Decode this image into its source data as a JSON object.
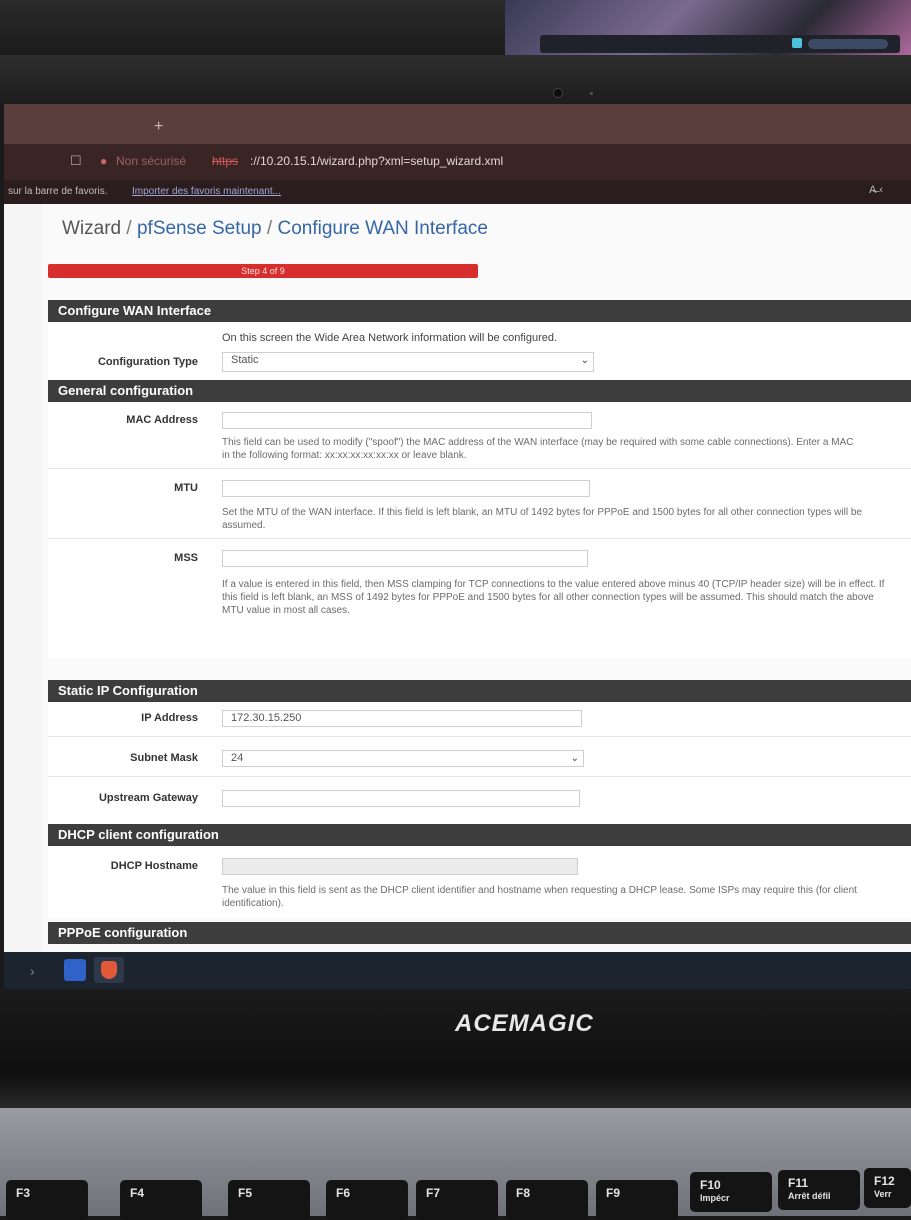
{
  "browser": {
    "tab_new": "+",
    "bookmark_icon": "bookmark-icon",
    "security_label": "Non sécurisé",
    "url_scheme": "https",
    "url_rest": "://10.20.15.1/wizard.php?xml=setup_wizard.xml",
    "bookmarks_bar_text": "sur la barre de favoris.",
    "bookmarks_import_link": "Importer des favoris maintenant...",
    "translate_icon": "translate-icon"
  },
  "breadcrumb": {
    "root": "Wizard",
    "sep": " / ",
    "middle": "pfSense Setup",
    "current": "Configure WAN Interface"
  },
  "progress": {
    "label": "Step 4 of 9",
    "step": 4,
    "total": 9,
    "color": "#d82d2d"
  },
  "sections": {
    "configure_wan": {
      "title": "Configure WAN Interface",
      "intro": "On this screen the Wide Area Network information will be configured.",
      "config_type_label": "Configuration Type",
      "config_type_value": "Static"
    },
    "general": {
      "title": "General configuration",
      "mac_label": "MAC Address",
      "mac_value": "",
      "mac_help_1": "This field can be used to modify (\"spoof\") the MAC address of the WAN interface (may be required with some cable connections). Enter a MAC",
      "mac_help_2": "in the following format: xx:xx:xx:xx:xx:xx or leave blank.",
      "mtu_label": "MTU",
      "mtu_value": "",
      "mtu_help_1": "Set the MTU of the WAN interface. If this field is left blank, an MTU of 1492 bytes for PPPoE and 1500 bytes for all other connection types will be",
      "mtu_help_2": "assumed.",
      "mss_label": "MSS",
      "mss_value": "",
      "mss_help_1": "If a value is entered in this field, then MSS clamping for TCP connections to the value entered above minus 40 (TCP/IP header size) will be in effect. If",
      "mss_help_2": "this field is left blank, an MSS of 1492 bytes for PPPoE and 1500 bytes for all other connection types will be assumed. This should match the above",
      "mss_help_3": "MTU value in most all cases."
    },
    "static_ip": {
      "title": "Static IP Configuration",
      "ip_label": "IP Address",
      "ip_value": "172.30.15.250",
      "mask_label": "Subnet Mask",
      "mask_value": "24",
      "gateway_label": "Upstream Gateway",
      "gateway_value": ""
    },
    "dhcp": {
      "title": "DHCP client configuration",
      "hostname_label": "DHCP Hostname",
      "hostname_value": "",
      "hostname_help_1": "The value in this field is sent as the DHCP client identifier and hostname when requesting a DHCP lease. Some ISPs may require this (for client",
      "hostname_help_2": "identification)."
    },
    "pppoe": {
      "title": "PPPoE configuration"
    }
  },
  "taskbar": {
    "chevron": "›",
    "apps": [
      "edge-icon",
      "brave-icon"
    ]
  },
  "laptop": {
    "brand": "ACEMAGIC"
  },
  "keyboard": {
    "keys": [
      {
        "label": "F3",
        "sub": ""
      },
      {
        "label": "F4",
        "sub": ""
      },
      {
        "label": "F5",
        "sub": ""
      },
      {
        "label": "F6",
        "sub": ""
      },
      {
        "label": "F7",
        "sub": ""
      },
      {
        "label": "F8",
        "sub": ""
      },
      {
        "label": "F9",
        "sub": ""
      },
      {
        "label": "F10",
        "sub": "Impécr"
      },
      {
        "label": "F11",
        "sub": "Arrêt défil"
      },
      {
        "label": "F12",
        "sub": "Verr"
      }
    ]
  }
}
